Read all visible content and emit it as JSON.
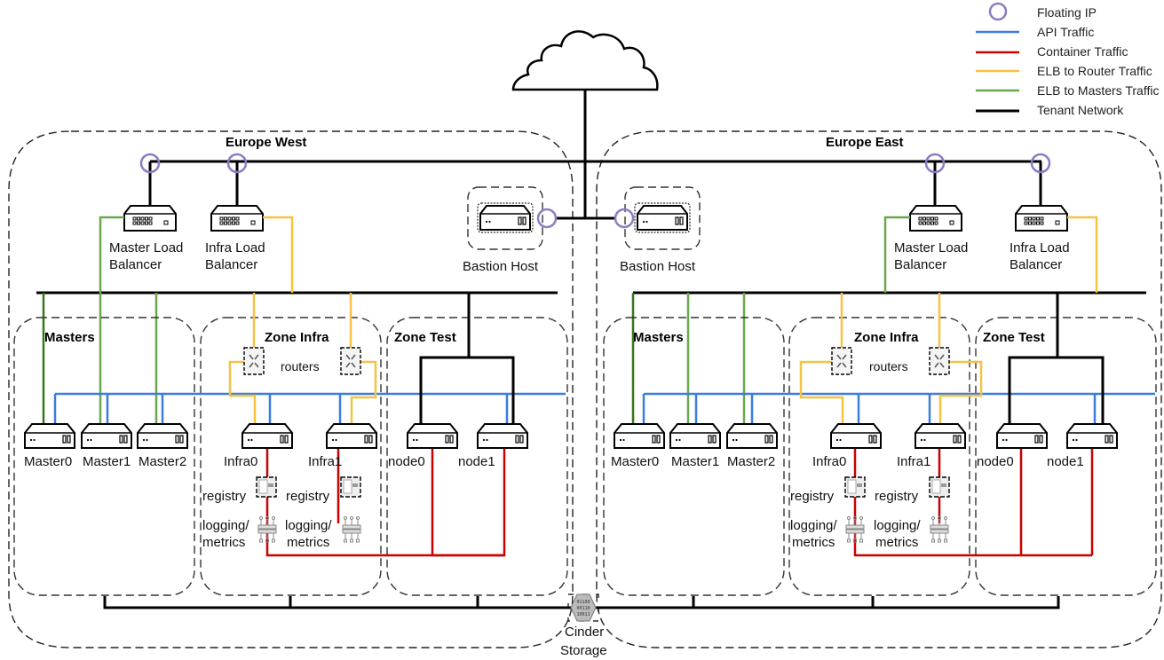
{
  "legend": {
    "items": [
      {
        "key": "floating_ip",
        "label": "Floating IP",
        "symbol": "circle",
        "color": "#8e7cc3"
      },
      {
        "key": "api",
        "label": "API Traffic",
        "symbol": "line",
        "color": "#3b7ddd"
      },
      {
        "key": "container",
        "label": "Container Traffic",
        "symbol": "line",
        "color": "#cc0000"
      },
      {
        "key": "elb_router",
        "label": "ELB to Router Traffic",
        "symbol": "line",
        "color": "#f5c242"
      },
      {
        "key": "elb_masters",
        "label": "ELB to Masters Traffic",
        "symbol": "line",
        "color": "#6aa84f"
      },
      {
        "key": "tenant",
        "label": "Tenant Network",
        "symbol": "line",
        "color": "#000000"
      }
    ]
  },
  "internet": {
    "icon": "cloud-icon"
  },
  "storage": {
    "line1": "Cinder",
    "line2": "Storage",
    "icon": "cinder-storage-icon"
  },
  "regions": {
    "west": {
      "title": "Europe West",
      "master_lb": {
        "line1": "Master Load",
        "line2": "Balancer"
      },
      "infra_lb": {
        "line1": "Infra Load",
        "line2": "Balancer"
      },
      "bastion": "Bastion Host",
      "zones": {
        "masters": {
          "title": "Masters",
          "nodes": [
            "Master0",
            "Master1",
            "Master2"
          ]
        },
        "infra": {
          "title": "Zone Infra",
          "routers_label": "routers",
          "nodes": [
            "Infra0",
            "Infra1"
          ],
          "registry_label": "registry",
          "logging_line1": "logging/",
          "logging_line2": "metrics"
        },
        "test": {
          "title": "Zone Test",
          "nodes": [
            "node0",
            "node1"
          ]
        }
      }
    },
    "east": {
      "title": "Europe East",
      "master_lb": {
        "line1": "Master Load",
        "line2": "Balancer"
      },
      "infra_lb": {
        "line1": "Infra Load",
        "line2": "Balancer"
      },
      "bastion": "Bastion Host",
      "zones": {
        "masters": {
          "title": "Masters",
          "nodes": [
            "Master0",
            "Master1",
            "Master2"
          ]
        },
        "infra": {
          "title": "Zone Infra",
          "routers_label": "routers",
          "nodes": [
            "Infra0",
            "Infra1"
          ],
          "registry_label": "registry",
          "logging_line1": "logging/",
          "logging_line2": "metrics"
        },
        "test": {
          "title": "Zone Test",
          "nodes": [
            "node0",
            "node1"
          ]
        }
      }
    }
  }
}
